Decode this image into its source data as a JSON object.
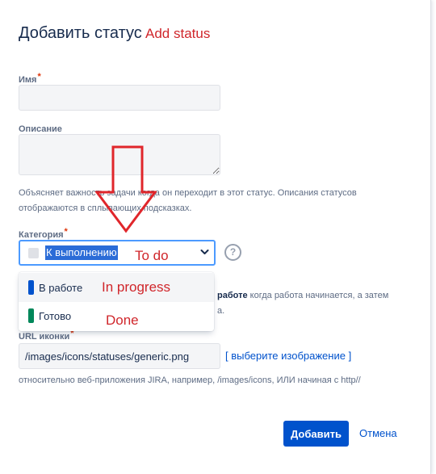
{
  "dialog": {
    "title": "Добавить статус",
    "annotation_title": "Add status"
  },
  "form": {
    "name": {
      "label": "Имя",
      "required_mark": "*",
      "value": ""
    },
    "description": {
      "label": "Описание",
      "value": "",
      "help_line1": "Объясняет важность задачи когда он переходит в этот статус. Описания статусов",
      "help_line2": "отображаются в сплывающих подсказках."
    },
    "category": {
      "label": "Категория",
      "required_mark": "*",
      "selected": "К выполнению",
      "selected_annotation": "To do",
      "help_icon": "question-circle-icon",
      "help_partial_bold": "работе",
      "help_partial_line1": " когда работа начинается, а затем",
      "help_partial_line2": "а.",
      "options": [
        {
          "label": "В работе",
          "color": "#0052cc",
          "annotation": "In progress"
        },
        {
          "label": "Готово",
          "color": "#00875a",
          "annotation": "Done"
        }
      ]
    },
    "icon_url": {
      "label": "URL иконки",
      "required_mark": "*",
      "value": "/images/icons/statuses/generic.png",
      "link_text": "[ выберите изображение ]",
      "help": "относительно веб-приложения JIRA, например, /images/icons, ИЛИ начиная с http//"
    }
  },
  "actions": {
    "submit_label": "Добавить",
    "cancel_label": "Отмена"
  },
  "annotations": {
    "arrow_color": "#e0262b"
  }
}
